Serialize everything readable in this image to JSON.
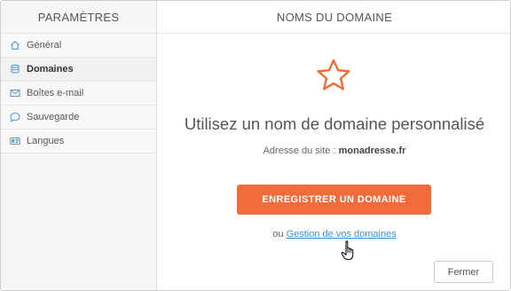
{
  "sidebar": {
    "title": "PARAMÈTRES",
    "items": [
      {
        "label": "Général",
        "icon": "home-icon"
      },
      {
        "label": "Domaines",
        "icon": "database-icon",
        "active": true
      },
      {
        "label": "Boîtes e-mail",
        "icon": "envelope-icon"
      },
      {
        "label": "Sauvegarde",
        "icon": "chat-bubble-icon"
      },
      {
        "label": "Langues",
        "icon": "language-card-icon"
      }
    ]
  },
  "main": {
    "title": "NOMS DU DOMAINE",
    "icon": "star-icon",
    "headline": "Utilisez un nom de domaine personnalisé",
    "site_label": "Adresse du site : ",
    "site_value": "monadresse.fr",
    "register_button": "ENREGISTRER UN DOMAINE",
    "manage_prefix": "ou ",
    "manage_link": "Gestion de vos domaines",
    "close_button": "Fermer"
  },
  "colors": {
    "accent": "#f26b39",
    "link": "#3a8fd0",
    "sidebar_bg": "#f6f6f6",
    "icon": "#5b9bd5"
  }
}
